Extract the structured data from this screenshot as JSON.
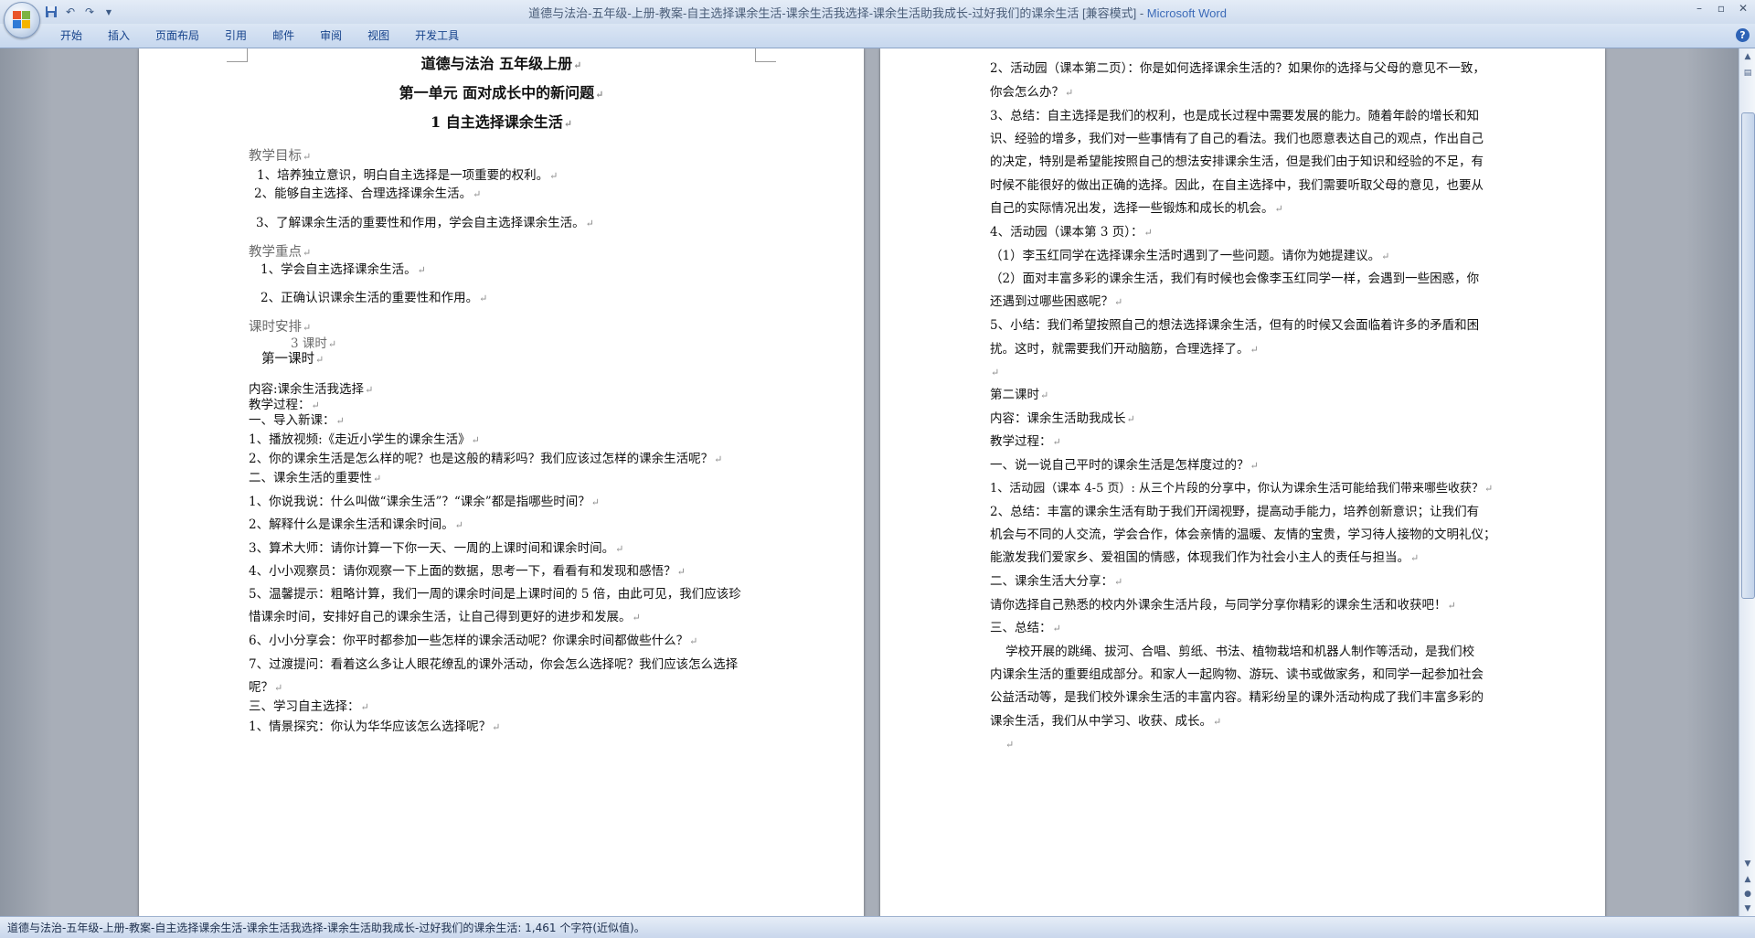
{
  "window": {
    "title_prefix": "道德与法治-五年级-上册-教案-自主选择课余生活-课余生活我选择-课余生活助我成长-过好我们的课余生活 [兼容模式] - ",
    "title_app": "Microsoft Word"
  },
  "ribbon": {
    "tabs": [
      "开始",
      "插入",
      "页面布局",
      "引用",
      "邮件",
      "审阅",
      "视图",
      "开发工具"
    ]
  },
  "doc": {
    "left": {
      "title1": "道德与法治  五年级上册",
      "title2": "第一单元  面对成长中的新问题",
      "title3": "1  自主选择课余生活",
      "goals_heading": "教学目标",
      "goal1": "1、培养独立意识，明白自主选择是一项重要的权利。",
      "goal2": "2、能够自主选择、合理选择课余生活。",
      "goal3": "3、了解课余生活的重要性和作用，学会自主选择课余生活。",
      "focus_heading": "教学重点",
      "focus1": "1、学会自主选择课余生活。",
      "focus2": "2、正确认识课余生活的重要性和作用。",
      "schedule_heading": "课时安排",
      "schedule_hours": "3 课时",
      "lesson1": "第一课时",
      "content": "内容:课余生活我选择",
      "process": "教学过程：",
      "intro": "一、导入新课：",
      "l1": "1、播放视频:《走近小学生的课余生活》",
      "l2": "2、你的课余生活是怎么样的呢？也是这般的精彩吗？我们应该过怎样的课余生活呢？",
      "sec2": "二、课余生活的重要性",
      "l3": "1、你说我说：什么叫做“课余生活”？“课余”都是指哪些时间？",
      "l4": "2、解释什么是课余生活和课余时间。",
      "l5": "3、算术大师：请你计算一下你一天、一周的上课时间和课余时间。",
      "l6": "4、小小观察员：请你观察一下上面的数据，思考一下，看看有和发现和感悟？",
      "l7a": "5、温馨提示：粗略计算，我们一周的课余时间是上课时间的 5 倍，由此可见，我们应该珍",
      "l7b": "惜课余时间，安排好自己的课余生活，让自己得到更好的进步和发展。",
      "l8": "6、小小分享会：你平时都参加一些怎样的课余活动呢？你课余时间都做些什么？",
      "l9a": "7、过渡提问：看着这么多让人眼花缭乱的课外活动，你会怎么选择呢？我们应该怎么选择",
      "l9b": "呢？",
      "sec3": "三、学习自主选择：",
      "l10": "1、情景探究：你认为华华应该怎么选择呢？"
    },
    "right": {
      "r1a": "2、活动园（课本第二页）：你是如何选择课余生活的？如果你的选择与父母的意见不一致，",
      "r1b": "你会怎么办？",
      "r2a": "3、总结：自主选择是我们的权利，也是成长过程中需要发展的能力。随着年龄的增长和知",
      "r2b": "识、经验的增多，我们对一些事情有了自己的看法。我们也愿意表达自己的观点，作出自己",
      "r2c": "的决定，特别是希望能按照自己的想法安排课余生活，但是我们由于知识和经验的不足，有",
      "r2d": "时候不能很好的做出正确的选择。因此，在自主选择中，我们需要听取父母的意见，也要从",
      "r2e": "自己的实际情况出发，选择一些锻炼和成长的机会。",
      "r3": "4、活动园（课本第 3 页）：",
      "r4": "（1）李玉红同学在选择课余生活时遇到了一些问题。请你为她提建议。",
      "r5a": "（2）面对丰富多彩的课余生活，我们有时候也会像李玉红同学一样，会遇到一些困惑，你",
      "r5b": "还遇到过哪些困惑呢？",
      "r6a": "5、小结：我们希望按照自己的想法选择课余生活，但有的时候又会面临着许多的矛盾和困",
      "r6b": "扰。这时，就需要我们开动脑筋，合理选择了。",
      "lesson2": "第二课时",
      "content2": "内容：课余生活助我成长",
      "process2": "教学过程：",
      "s1": "一、说一说自己平时的课余生活是怎样度过的？",
      "r7": "1、活动园（课本 4-5 页）: 从三个片段的分享中，你认为课余生活可能给我们带来哪些收获？",
      "r8a": "2、总结：丰富的课余生活有助于我们开阔视野，提高动手能力，培养创新意识；让我们有",
      "r8b": "机会与不同的人交流，学会合作，体会亲情的温暖、友情的宝贵，学习待人接物的文明礼仪；",
      "r8c": "能激发我们爱家乡、爱祖国的情感，体现我们作为社会小主人的责任与担当。",
      "s2": "二、课余生活大分享：",
      "r9": "请你选择自己熟悉的校内外课余生活片段，与同学分享你精彩的课余生活和收获吧！",
      "s3": "三、总结：",
      "r10a": "    学校开展的跳绳、拔河、合唱、剪纸、书法、植物栽培和机器人制作等活动，是我们校",
      "r10b": "内课余生活的重要组成部分。和家人一起购物、游玩、读书或做家务，和同学一起参加社会",
      "r10c": "公益活动等，是我们校外课余生活的丰富内容。精彩纷呈的课外活动构成了我们丰富多彩的",
      "r10d": "课余生活，我们从中学习、收获、成长。"
    }
  },
  "paragraph_mark": "↵",
  "status": {
    "text": "道德与法治-五年级-上册-教案-自主选择课余生活-课余生活我选择-课余生活助我成长-过好我们的课余生活: 1,461 个字符(近似值)。"
  },
  "colors": {
    "brand": "#3c6bb8",
    "ribbon_tab_text": "#15428b",
    "heading_gray": "#6c6c6c"
  },
  "icons": [
    "office-button-icon",
    "save-icon",
    "undo-icon",
    "redo-icon",
    "customize-qat-icon",
    "minimize-icon",
    "maximize-icon",
    "close-icon",
    "help-icon"
  ]
}
